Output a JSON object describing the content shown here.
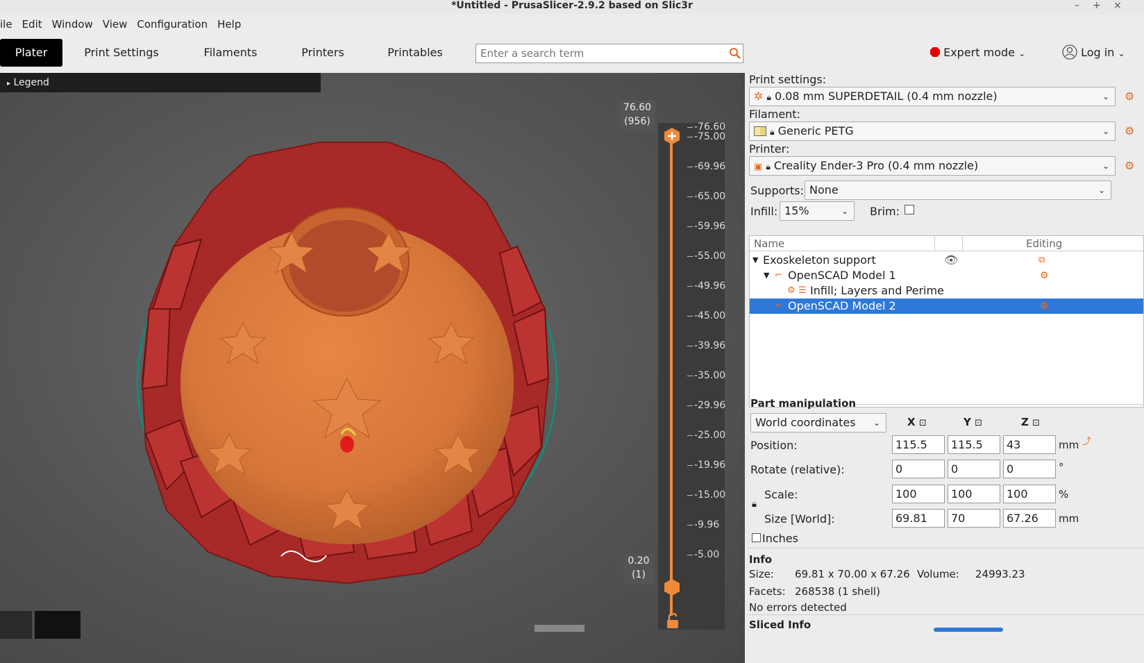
{
  "window": {
    "title": "*Untitled - PrusaSlicer-2.9.2 based on Slic3r"
  },
  "menubar": [
    "ile",
    "Edit",
    "Window",
    "View",
    "Configuration",
    "Help"
  ],
  "tabs": {
    "plater": "Plater",
    "print_settings": "Print Settings",
    "filaments": "Filaments",
    "printers": "Printers",
    "printables": "Printables"
  },
  "search": {
    "placeholder": "Enter a search term"
  },
  "mode": {
    "label": "Expert mode",
    "color": "#e00000"
  },
  "account": {
    "label": "Log in"
  },
  "viewport": {
    "legend": "Legend",
    "slider": {
      "top_value": "76.60",
      "top_layer": "(956)",
      "bottom_value": "0.20",
      "bottom_layer": "(1)",
      "ticks": [
        "76.60",
        "75.00",
        "69.96",
        "65.00",
        "59.96",
        "55.00",
        "49.96",
        "45.00",
        "39.96",
        "35.00",
        "29.96",
        "25.00",
        "19.96",
        "15.00",
        "9.96",
        "5.00"
      ]
    }
  },
  "panel": {
    "print_settings_label": "Print settings:",
    "print_settings_value": "0.08 mm SUPERDETAIL (0.4 mm nozzle)",
    "filament_label": "Filament:",
    "filament_value": "Generic PETG",
    "printer_label": "Printer:",
    "printer_value": "Creality Ender-3 Pro (0.4 mm nozzle)",
    "supports_label": "Supports:",
    "supports_value": "None",
    "infill_label": "Infill:",
    "infill_value": "15%",
    "brim_label": "Brim:",
    "tree": {
      "col_name": "Name",
      "col_editing": "Editing",
      "rows": [
        "Exoskeleton support",
        "OpenSCAD Model 1",
        "Infill; Layers and Perime",
        "OpenSCAD Model 2"
      ]
    },
    "part_manipulation": {
      "title": "Part manipulation",
      "coord_system": "World coordinates",
      "axes": [
        "X",
        "Y",
        "Z"
      ],
      "position_label": "Position:",
      "position": [
        "115.5",
        "115.5",
        "43"
      ],
      "position_unit": "mm",
      "rotate_label": "Rotate (relative):",
      "rotate": [
        "0",
        "0",
        "0"
      ],
      "rotate_unit": "°",
      "scale_label": "Scale:",
      "scale": [
        "100",
        "100",
        "100"
      ],
      "scale_unit": "%",
      "size_label": "Size [World]:",
      "size": [
        "69.81",
        "70",
        "67.26"
      ],
      "size_unit": "mm",
      "inches_label": "Inches"
    },
    "info": {
      "title": "Info",
      "size_label": "Size:",
      "size_value": "69.81 x 70.00 x 67.26",
      "volume_label": "Volume:",
      "volume_value": "24993.23",
      "facets_label": "Facets:",
      "facets_value": "268538 (1 shell)",
      "errors": "No errors detected"
    },
    "sliced_info_title": "Sliced Info"
  }
}
